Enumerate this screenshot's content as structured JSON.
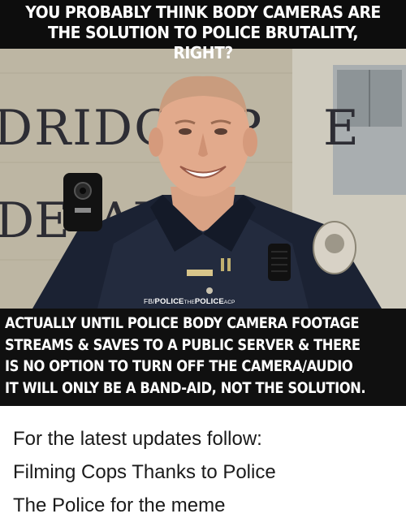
{
  "meme": {
    "top_caption": [
      "YOU PROBABLY THINK BODY CAMERAS ARE",
      "THE SOLUTION TO POLICE BRUTALITY, RIGHT?"
    ],
    "sign_text_line1": "DRIDGE P",
    "sign_text_line1_end": "E",
    "sign_text_line2_start": "DE",
    "sign_text_line2_end": "ART",
    "credit_prefix": "FB/",
    "credit_main1": "POLICE",
    "credit_small": "THE",
    "credit_main2": "POLICE",
    "credit_suffix": "ACP",
    "bottom_caption": [
      "ACTUALLY UNTIL POLICE BODY CAMERA FOOTAGE",
      "STREAMS & SAVES TO A PUBLIC SERVER & THERE",
      "IS NO OPTION TO TURN OFF THE CAMERA/AUDIO",
      "IT WILL ONLY BE A BAND-AID, NOT THE SOLUTION."
    ]
  },
  "footer": {
    "lines": [
      "For the latest updates follow:",
      "Filming Cops Thanks to Police",
      "The Police for the meme"
    ]
  },
  "colors": {
    "caption_band": "#0d0d0d",
    "caption_text": "#ffffff",
    "uniform": "#1b2233",
    "wall": "#c9c2ae",
    "sign_text": "#2d2d34",
    "footer_text": "#1a1a1a"
  }
}
